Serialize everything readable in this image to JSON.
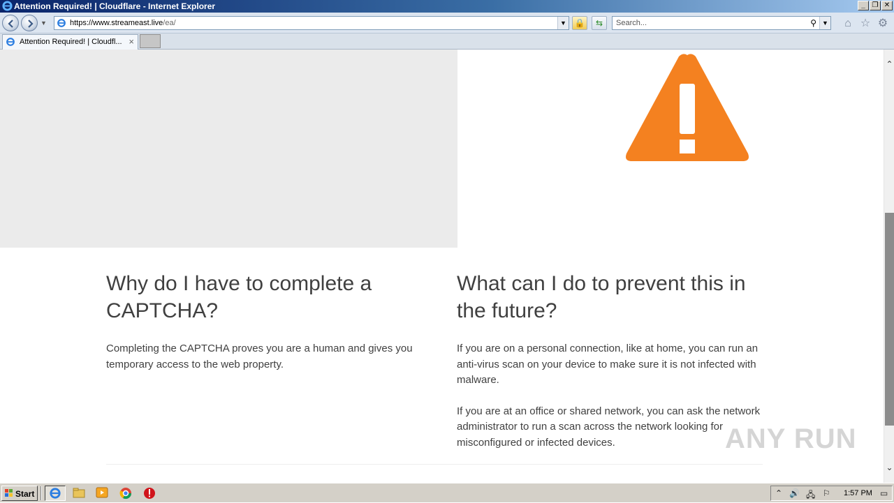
{
  "window": {
    "title": "Attention Required! | Cloudflare - Internet Explorer",
    "controls": {
      "minimize": "_",
      "restore": "❐",
      "close": "✕"
    }
  },
  "toolbar": {
    "url_prefix": "https://www.",
    "url_host": "streameast.live",
    "url_path": "/ea/",
    "search_placeholder": "Search...",
    "icons": [
      "back-icon",
      "forward-icon",
      "lock-icon",
      "refresh-icon",
      "search-icon",
      "home-icon",
      "favorites-star-icon",
      "gear-icon"
    ]
  },
  "tabs": [
    {
      "label": "Attention Required! | Cloudfl...",
      "close": "×"
    }
  ],
  "page": {
    "col1": {
      "heading": "Why do I have to complete a CAPTCHA?",
      "paragraphs": [
        "Completing the CAPTCHA proves you are a human and gives you temporary access to the web property."
      ]
    },
    "col2": {
      "heading": "What can I do to prevent this in the future?",
      "paragraphs": [
        "If you are on a personal connection, like at home, you can run an anti-virus scan on your device to make sure it is not infected with malware.",
        "If you are at an office or shared network, you can ask the network administrator to run a scan across the network looking for misconfigured or infected devices."
      ]
    },
    "warning_color": "#f48120",
    "watermark": "ANY RUN"
  },
  "taskbar": {
    "start_label": "Start",
    "clock": "1:57 PM"
  }
}
